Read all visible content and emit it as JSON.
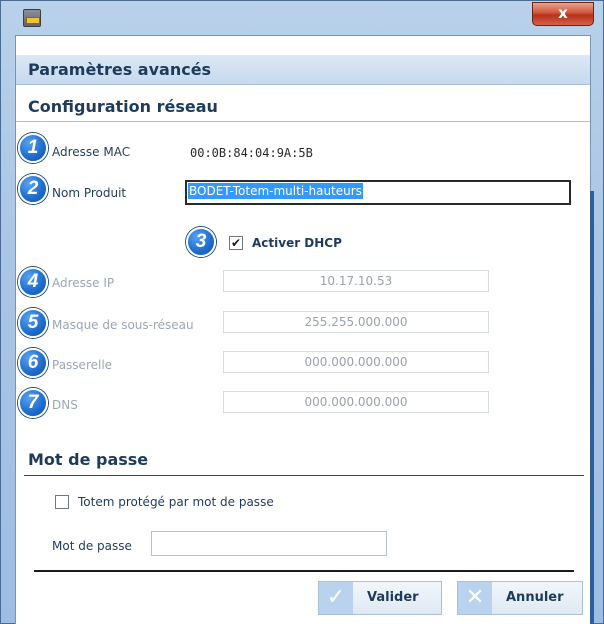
{
  "window": {
    "close_glyph": "x"
  },
  "page_title": "Paramètres avancés",
  "network": {
    "heading": "Configuration réseau",
    "mac_label": "Adresse MAC",
    "mac_value": "00:0B:84:04:9A:5B",
    "product_label": "Nom Produit",
    "product_value": "BODET-Totem-multi-hauteurs",
    "dhcp_label": "Activer DHCP",
    "dhcp_checked": true,
    "ip_label": "Adresse IP",
    "ip_value": "10.17.10.53",
    "mask_label": "Masque de sous-réseau",
    "mask_value": "255.255.000.000",
    "gateway_label": "Passerelle",
    "gateway_value": "000.000.000.000",
    "dns_label": "DNS",
    "dns_value": "000.000.000.000"
  },
  "badges": [
    "1",
    "2",
    "3",
    "4",
    "5",
    "6",
    "7"
  ],
  "password": {
    "heading": "Mot de passe",
    "protect_label": "Totem protégé par mot de passe",
    "protect_checked": false,
    "field_label": "Mot de passe",
    "field_value": ""
  },
  "footer": {
    "validate_label": "Valider",
    "cancel_label": "Annuler",
    "check_glyph": "✓",
    "cross_glyph": "✕"
  },
  "colors": {
    "accent": "#1f6fd1",
    "header_text": "#1f3b5c",
    "selection": "#3399ff"
  }
}
